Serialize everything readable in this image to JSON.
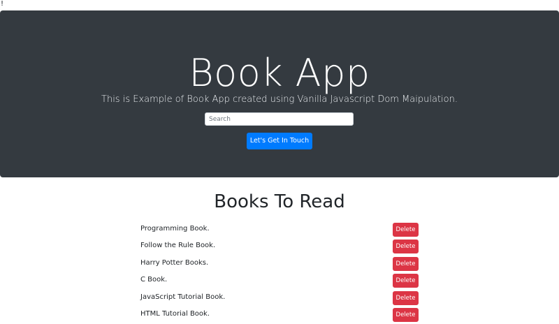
{
  "page": {
    "stray_mark": "!"
  },
  "hero": {
    "title": "Book App",
    "lead": "This is Example of Book App created using Vanilla Javascript Dom Maipulation.",
    "search_placeholder": "Search",
    "search_value": "",
    "cta_label": "Let's Get In Touch"
  },
  "books": {
    "heading": "Books To Read",
    "delete_label": "Delete",
    "items": [
      {
        "name": "Programming Book."
      },
      {
        "name": "Follow the Rule Book."
      },
      {
        "name": "Harry Potter Books."
      },
      {
        "name": "C Book."
      },
      {
        "name": "JavaScript Tutorial Book."
      },
      {
        "name": "HTML Tutorial Book."
      }
    ]
  },
  "colors": {
    "hero_background": "#343a40",
    "primary": "#007bff",
    "danger": "#dc3545"
  }
}
